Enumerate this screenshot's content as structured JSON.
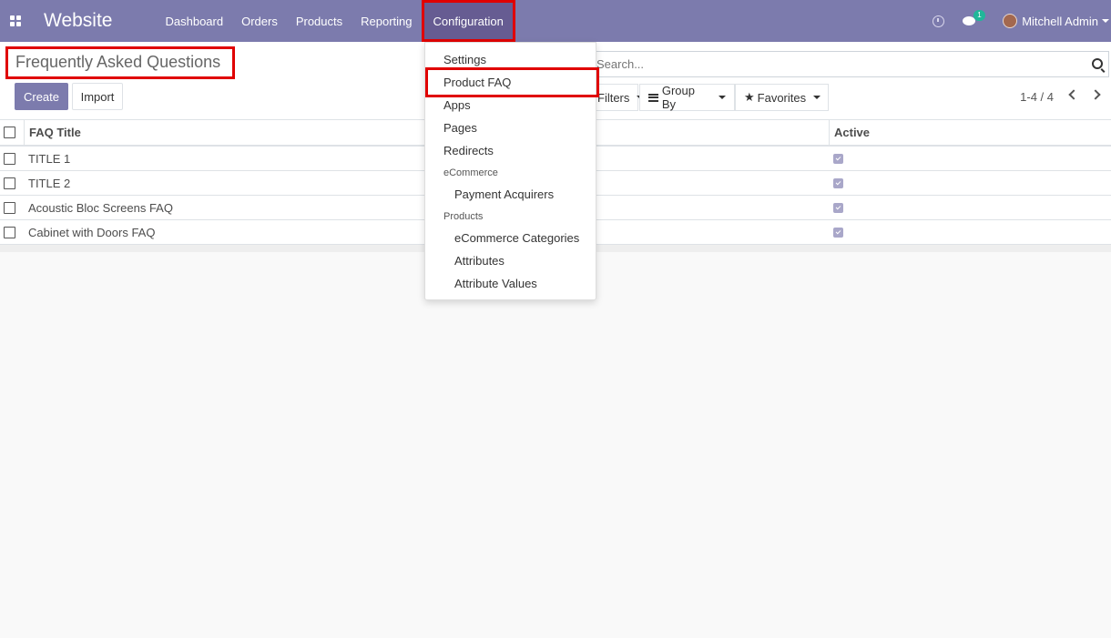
{
  "navbar": {
    "brand": "Website",
    "menu": [
      "Dashboard",
      "Orders",
      "Products",
      "Reporting",
      "Configuration"
    ],
    "chat_badge": "1",
    "user": "Mitchell Admin"
  },
  "control": {
    "breadcrumb": "Frequently Asked Questions",
    "create_label": "Create",
    "import_label": "Import",
    "search_placeholder": "Search...",
    "filters_label": "Filters",
    "groupby_label": "Group By",
    "favorites_label": "Favorites",
    "pager": "1-4 / 4"
  },
  "table": {
    "columns": [
      "FAQ Title",
      "Active"
    ],
    "rows": [
      {
        "title": "TITLE 1",
        "active": true
      },
      {
        "title": "TITLE 2",
        "active": true
      },
      {
        "title": "Acoustic Bloc Screens FAQ",
        "active": true
      },
      {
        "title": "Cabinet with Doors FAQ",
        "active": true
      }
    ]
  },
  "dropdown": {
    "items": [
      "Settings",
      "Product FAQ",
      "Apps",
      "Pages",
      "Redirects"
    ],
    "section_ecommerce": "eCommerce",
    "ecommerce_items": [
      "Payment Acquirers"
    ],
    "section_products": "Products",
    "products_items": [
      "eCommerce Categories",
      "Attributes",
      "Attribute Values"
    ]
  },
  "colors": {
    "navbar": "#7c7bad",
    "primary": "#7c7bad",
    "highlight": "#e00000",
    "badge": "#21b799"
  }
}
